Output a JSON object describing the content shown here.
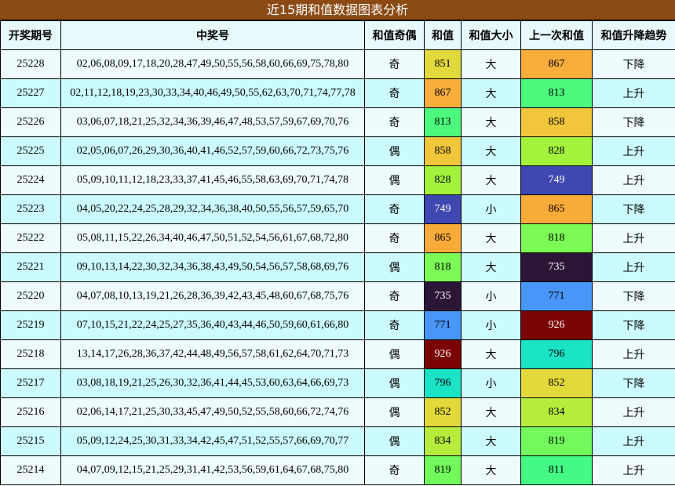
{
  "title": "近15期和值数据图表分析",
  "headers": [
    "开奖期号",
    "中奖号",
    "和值奇偶",
    "和值",
    "和值大小",
    "上一次和值",
    "和值升降趋势"
  ],
  "rows": [
    {
      "issue": "25228",
      "numbers": "02,06,08,09,17,18,20,28,47,49,50,55,56,58,60,66,69,75,78,80",
      "parity": "奇",
      "sum": "851",
      "size": "大",
      "prev": "867",
      "trend": "下降",
      "sum_color": "#e2d93c",
      "prev_color": "#f9ad3a"
    },
    {
      "issue": "25227",
      "numbers": "02,11,12,18,19,23,30,33,34,40,46,49,50,55,62,63,70,71,74,77,78",
      "parity": "奇",
      "sum": "867",
      "size": "大",
      "prev": "813",
      "trend": "上升",
      "sum_color": "#f9ad3a",
      "prev_color": "#4dfa7d"
    },
    {
      "issue": "25226",
      "numbers": "03,06,07,18,21,25,32,34,36,39,46,47,48,53,57,59,67,69,70,76",
      "parity": "奇",
      "sum": "813",
      "size": "大",
      "prev": "858",
      "trend": "下降",
      "sum_color": "#4dfa7d",
      "prev_color": "#f1c63b"
    },
    {
      "issue": "25225",
      "numbers": "02,05,06,07,26,29,30,36,40,41,46,52,57,59,60,66,72,73,75,76",
      "parity": "偶",
      "sum": "858",
      "size": "大",
      "prev": "828",
      "trend": "上升",
      "sum_color": "#f1c63b",
      "prev_color": "#a3f33c"
    },
    {
      "issue": "25224",
      "numbers": "05,09,10,11,12,18,23,33,37,41,45,46,55,58,63,69,70,71,74,78",
      "parity": "偶",
      "sum": "828",
      "size": "大",
      "prev": "749",
      "trend": "上升",
      "sum_color": "#a3f33c",
      "prev_color": "#3f47b0"
    },
    {
      "issue": "25223",
      "numbers": "04,05,20,22,24,25,28,29,32,34,36,38,40,50,55,56,57,59,65,70",
      "parity": "奇",
      "sum": "749",
      "size": "小",
      "prev": "865",
      "trend": "下降",
      "sum_color": "#3f47b0",
      "prev_color": "#f9ab39"
    },
    {
      "issue": "25222",
      "numbers": "05,08,11,15,22,26,34,40,46,47,50,51,52,54,56,61,67,68,72,80",
      "parity": "奇",
      "sum": "865",
      "size": "大",
      "prev": "818",
      "trend": "上升",
      "sum_color": "#f9ab39",
      "prev_color": "#7cfa55"
    },
    {
      "issue": "25221",
      "numbers": "09,10,13,14,22,30,32,34,36,38,43,49,50,54,56,57,58,68,69,76",
      "parity": "偶",
      "sum": "818",
      "size": "大",
      "prev": "735",
      "trend": "上升",
      "sum_color": "#7cfa55",
      "prev_color": "#2c1638"
    },
    {
      "issue": "25220",
      "numbers": "04,07,08,10,13,19,21,26,28,36,39,42,43,45,48,60,67,68,75,76",
      "parity": "奇",
      "sum": "735",
      "size": "小",
      "prev": "771",
      "trend": "下降",
      "sum_color": "#2c1638",
      "prev_color": "#4896f8"
    },
    {
      "issue": "25219",
      "numbers": "07,10,15,21,22,24,25,27,35,36,40,43,44,46,50,59,60,61,66,80",
      "parity": "奇",
      "sum": "771",
      "size": "小",
      "prev": "926",
      "trend": "下降",
      "sum_color": "#4896f8",
      "prev_color": "#7a0403"
    },
    {
      "issue": "25218",
      "numbers": "13,14,17,26,28,36,37,42,44,48,49,56,57,58,61,62,64,70,71,73",
      "parity": "偶",
      "sum": "926",
      "size": "大",
      "prev": "796",
      "trend": "上升",
      "sum_color": "#7a0403",
      "prev_color": "#1ae3c6"
    },
    {
      "issue": "25217",
      "numbers": "03,08,18,19,21,25,26,30,32,36,41,44,45,53,60,63,64,66,69,73",
      "parity": "偶",
      "sum": "796",
      "size": "小",
      "prev": "852",
      "trend": "下降",
      "sum_color": "#1ae3c6",
      "prev_color": "#e3d93b"
    },
    {
      "issue": "25216",
      "numbers": "02,06,14,17,21,25,30,33,45,47,49,50,52,55,58,60,66,72,74,76",
      "parity": "偶",
      "sum": "852",
      "size": "大",
      "prev": "834",
      "trend": "上升",
      "sum_color": "#e3d93b",
      "prev_color": "#b6ec3c"
    },
    {
      "issue": "25215",
      "numbers": "05,09,12,24,25,30,31,33,34,42,45,47,51,52,55,57,66,69,70,77",
      "parity": "偶",
      "sum": "834",
      "size": "大",
      "prev": "819",
      "trend": "上升",
      "sum_color": "#b6ec3c",
      "prev_color": "#72fa5c"
    },
    {
      "issue": "25214",
      "numbers": "04,07,09,12,15,21,25,29,31,41,42,53,56,59,61,64,67,68,75,80",
      "parity": "奇",
      "sum": "819",
      "size": "大",
      "prev": "811",
      "trend": "上升",
      "sum_color": "#72fa5c",
      "prev_color": "#44fa85"
    }
  ]
}
